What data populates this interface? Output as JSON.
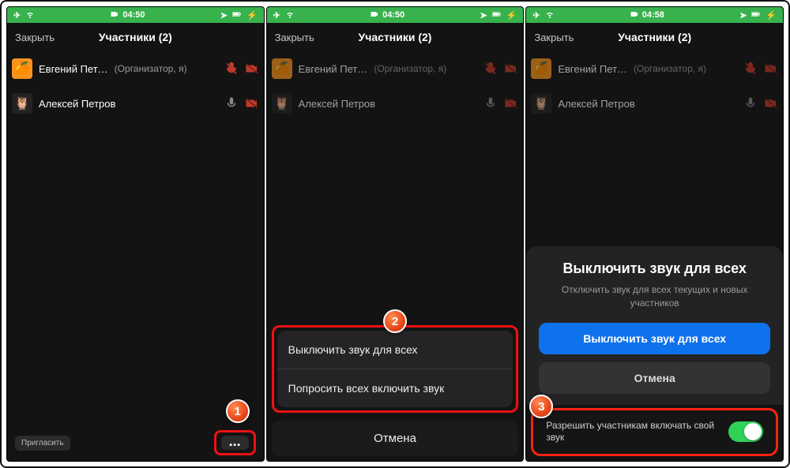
{
  "screens": [
    {
      "time": "04:50"
    },
    {
      "time": "04:50"
    },
    {
      "time": "04:58"
    }
  ],
  "header": {
    "close": "Закрыть",
    "title": "Участники (2)"
  },
  "participants": [
    {
      "name": "Евгений Пет…",
      "role": "(Организатор, я)"
    },
    {
      "name": "Алексей Петров",
      "role": ""
    }
  ],
  "bottom": {
    "invite": "Пригласить",
    "more": "..."
  },
  "sheet": {
    "opt1": "Выключить звук для всех",
    "opt2": "Попросить всех включить звук",
    "cancel": "Отмена"
  },
  "dialog": {
    "title": "Выключить звук для всех",
    "subtitle": "Отключить звук для всех текущих и новых участников",
    "primary": "Выключить звук для всех",
    "secondary": "Отмена",
    "permit": "Разрешить участникам включать свой звук"
  },
  "badges": {
    "b1": "1",
    "b2": "2",
    "b3": "3"
  }
}
